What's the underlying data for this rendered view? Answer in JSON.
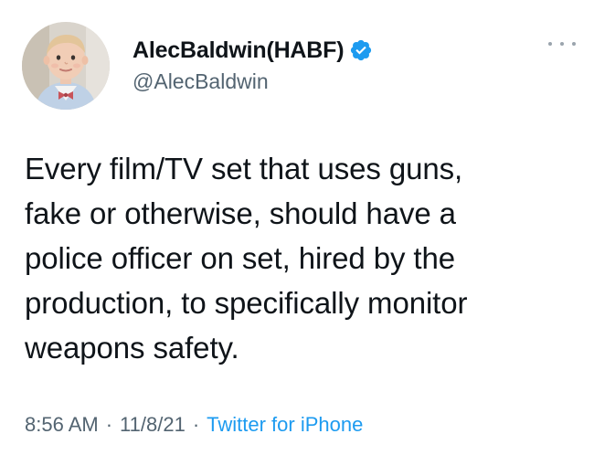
{
  "author": {
    "display_name": "AlecBaldwin(HABF)",
    "handle": "@AlecBaldwin",
    "verified": true,
    "avatar_icon": "toddler-avatar-with-bowtie"
  },
  "tweet": {
    "text": "Every film/TV set that uses guns,\nfake or otherwise, should have a\npolice officer on set, hired by the\nproduction, to specifically monitor\nweapons safety."
  },
  "meta": {
    "time": "8:56 AM",
    "separator": "·",
    "date": "11/8/21",
    "source": "Twitter for iPhone"
  },
  "icons": {
    "verified": "verified-badge-icon",
    "more": "more-options-icon"
  },
  "colors": {
    "text": "#0f1419",
    "secondary": "#536471",
    "accent": "#1d9bf0"
  }
}
